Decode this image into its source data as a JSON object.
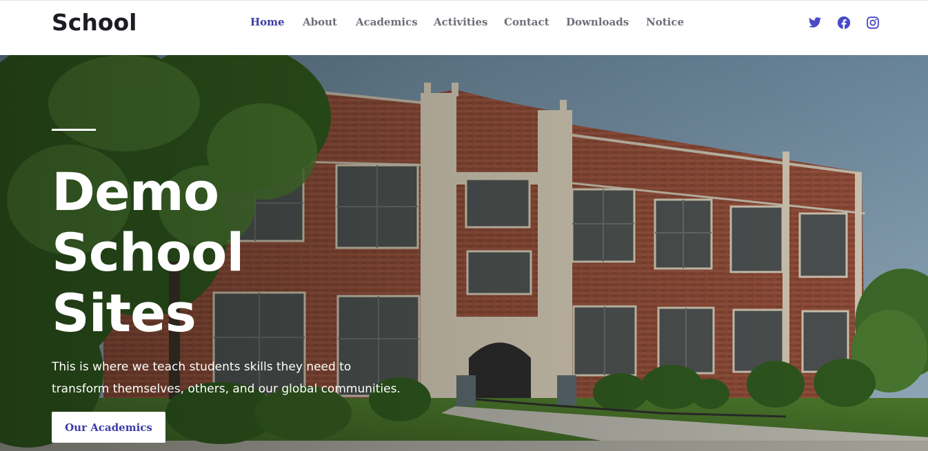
{
  "header": {
    "logo": "School",
    "nav": [
      {
        "label": "Home",
        "active": true
      },
      {
        "label": "About",
        "active": false
      },
      {
        "label": "Academics",
        "active": false
      },
      {
        "label": "Activities",
        "active": false
      },
      {
        "label": "Contact",
        "active": false
      },
      {
        "label": "Downloads",
        "active": false
      },
      {
        "label": "Notice",
        "active": false
      }
    ],
    "social": [
      "twitter-icon",
      "facebook-icon",
      "instagram-icon"
    ]
  },
  "hero": {
    "title_lines": [
      "Demo",
      "School",
      "Sites"
    ],
    "subtitle_lines": [
      "This is where we teach students skills they need to",
      "transform themselves, others, and our global communities."
    ],
    "cta_label": "Our Academics",
    "background": "school-building-photo"
  },
  "colors": {
    "accent": "#3c3ca8",
    "nav_text": "#6e6e7a",
    "logo_text": "#1c1c24",
    "social_icon": "#4a4ac8"
  }
}
